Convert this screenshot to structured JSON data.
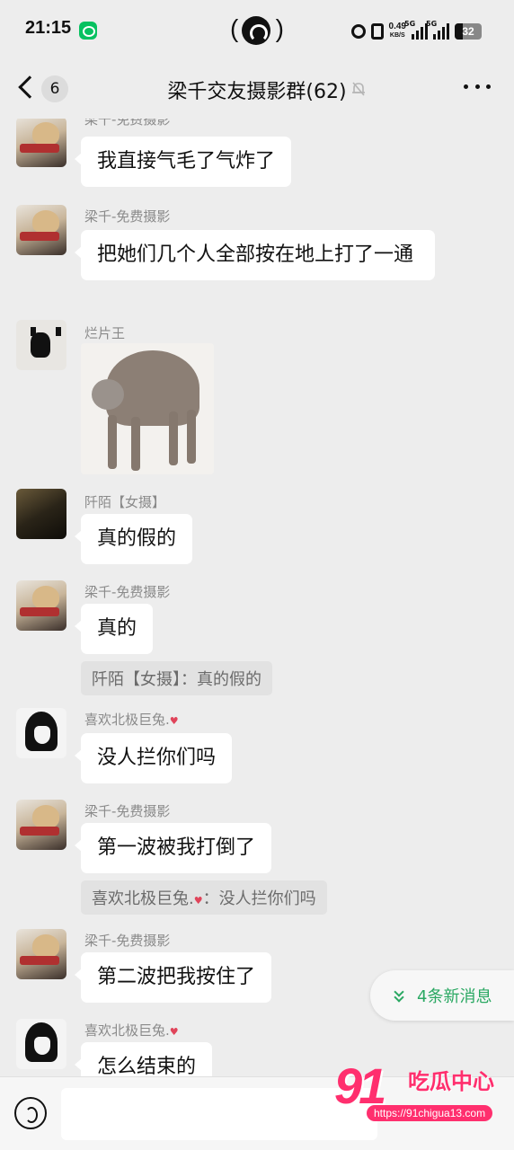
{
  "status_bar": {
    "time": "21:15",
    "network_speed_value": "0.49",
    "network_speed_unit": "KB/S",
    "sim1_label": "5G",
    "sim2_label": "5G",
    "battery": "32"
  },
  "header": {
    "back_count": "6",
    "title": "梁千交友摄影群(62)"
  },
  "messages": [
    {
      "sender": "梁千-免费摄影",
      "text": "我直接气毛了气炸了"
    },
    {
      "sender": "梁千-免费摄影",
      "text": "把她们几个人全部按在地上打了一通"
    },
    {
      "sender": "烂片王",
      "image": "cat-sticker"
    },
    {
      "sender": "阡陌【女摄】",
      "text": "真的假的"
    },
    {
      "sender": "梁千-免费摄影",
      "text": "真的",
      "quote": "阡陌【女摄】：真的假的"
    },
    {
      "sender": "喜欢北极巨兔.",
      "text": "没人拦你们吗"
    },
    {
      "sender": "梁千-免费摄影",
      "text": "第一波被我打倒了",
      "quote_name": "喜欢北极巨兔.",
      "quote_text": "：没人拦你们吗"
    },
    {
      "sender": "梁千-免费摄影",
      "text": "第二波把我按住了"
    },
    {
      "sender": "喜欢北极巨兔.",
      "text": "怎么结束的"
    }
  ],
  "new_messages_label": "4条新消息",
  "watermark": {
    "number": "91",
    "name": "吃瓜中心",
    "url": "https://91chigua13.com"
  },
  "colors": {
    "background": "#ededed",
    "bubble": "#ffffff",
    "accent_green": "#2aa862",
    "watermark_pink": "#ff2f6e"
  }
}
